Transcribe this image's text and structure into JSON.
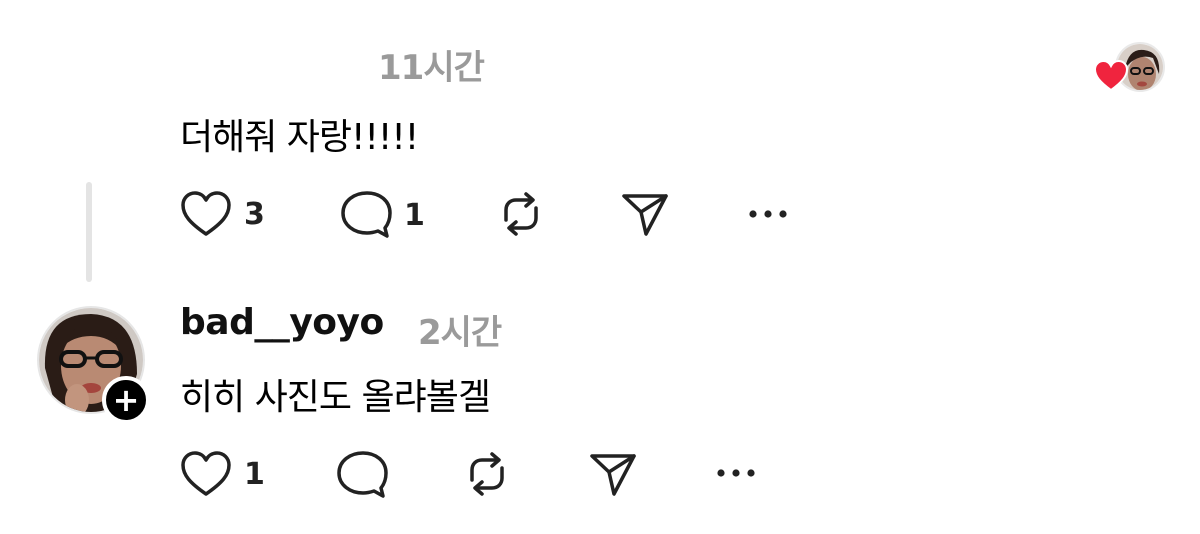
{
  "post1": {
    "time": "11시간",
    "text": "더해줘 자랑!!!!!",
    "likes": "3",
    "replies": "1"
  },
  "post2": {
    "username": "bad__yoyo",
    "time": "2시간",
    "text": "히히 사진도 올랴볼겔",
    "likes": "1"
  },
  "icons": {
    "heart": "heart-icon",
    "reply": "speech-bubble-icon",
    "repost": "repost-icon",
    "share": "paper-plane-icon",
    "more": "ellipsis-icon",
    "follow": "plus-icon",
    "liked": "red-heart-icon"
  },
  "colors": {
    "liked_heart": "#f0243e",
    "muted_text": "#9a9a9a",
    "thread_line": "#e4e4e4"
  }
}
